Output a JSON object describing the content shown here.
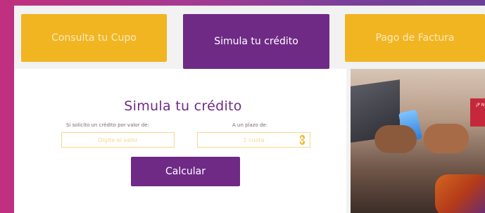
{
  "tabs": {
    "consulta": "Consulta tu Cupo",
    "simula": "Simula tu crédito",
    "pago": "Pago de Factura"
  },
  "form": {
    "title": "Simula tu crédito",
    "amount_label": "Si solicito un crédito por valor de:",
    "term_label": "A un plazo de:",
    "amount_placeholder": "Digite el valor",
    "term_value": "1 cuota",
    "submit_label": "Calcular"
  },
  "promo": {
    "text": "¡P\nN"
  },
  "colors": {
    "brand_purple": "#6f2a86",
    "brand_yellow": "#f2b522"
  }
}
